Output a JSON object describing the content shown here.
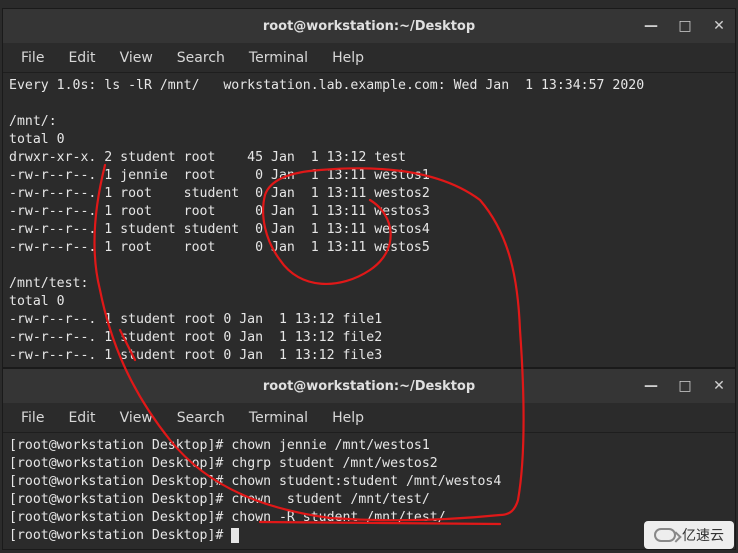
{
  "window1": {
    "title": "root@workstation:~/Desktop",
    "menubar": [
      "File",
      "Edit",
      "View",
      "Search",
      "Terminal",
      "Help"
    ],
    "lines": [
      "Every 1.0s: ls -lR /mnt/   workstation.lab.example.com: Wed Jan  1 13:34:57 2020",
      "",
      "/mnt/:",
      "total 0",
      "drwxr-xr-x. 2 student root    45 Jan  1 13:12 test",
      "-rw-r--r--. 1 jennie  root     0 Jan  1 13:11 westos1",
      "-rw-r--r--. 1 root    student  0 Jan  1 13:11 westos2",
      "-rw-r--r--. 1 root    root     0 Jan  1 13:11 westos3",
      "-rw-r--r--. 1 student student  0 Jan  1 13:11 westos4",
      "-rw-r--r--. 1 root    root     0 Jan  1 13:11 westos5",
      "",
      "/mnt/test:",
      "total 0",
      "-rw-r--r--. 1 student root 0 Jan  1 13:12 file1",
      "-rw-r--r--. 1 student root 0 Jan  1 13:12 file2",
      "-rw-r--r--. 1 student root 0 Jan  1 13:12 file3"
    ]
  },
  "window2": {
    "title": "root@workstation:~/Desktop",
    "menubar": [
      "File",
      "Edit",
      "View",
      "Search",
      "Terminal",
      "Help"
    ],
    "prompt": "[root@workstation Desktop]# ",
    "commands": [
      "chown jennie /mnt/westos1",
      "chgrp student /mnt/westos2",
      "chown student:student /mnt/westos4",
      "chown  student /mnt/test/",
      "chown -R student /mnt/test/",
      ""
    ]
  },
  "watermark": "亿速云",
  "controls": {
    "min": "—",
    "max": "□",
    "close": "✕"
  },
  "annotation_color": "#e01818"
}
